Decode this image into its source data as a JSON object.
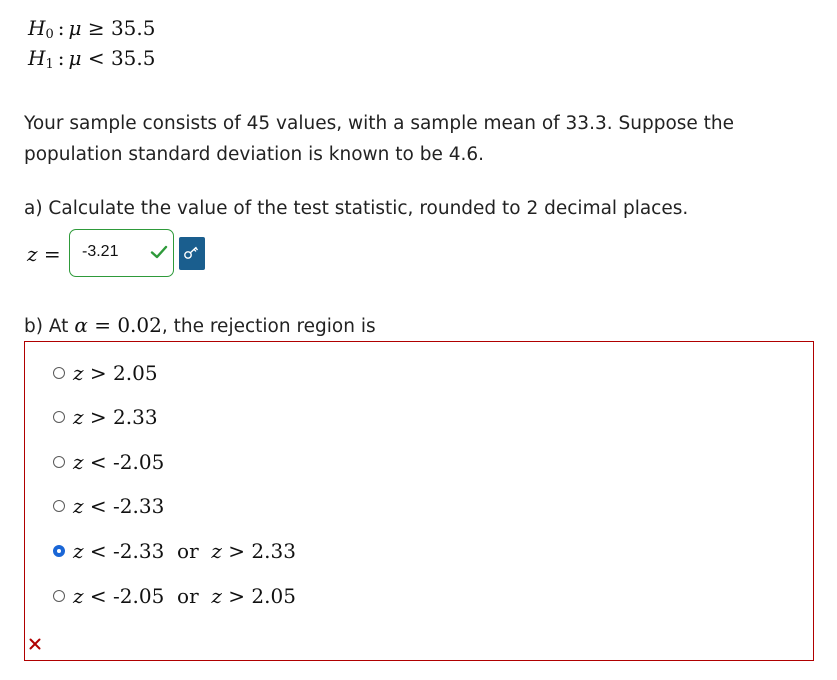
{
  "hypotheses": {
    "h0_sub": "0",
    "h0_rel": "≥",
    "h0_value": "35.5",
    "h1_sub": "1",
    "h1_rel": "<",
    "h1_value": "35.5"
  },
  "problem_text": "Your sample consists of 45 values, with a sample mean of 33.3. Suppose the population standard deviation is known to be 4.6.",
  "part_a": {
    "question": "a) Calculate the value of the test statistic, rounded to 2 decimal places.",
    "answer_value": "-3.21",
    "status": "correct",
    "accent_color": "#2e9a3a",
    "key_button_color": "#1a5e8e"
  },
  "part_b": {
    "prefix": "b) At",
    "alpha_value": "0.02",
    "suffix": ", the rejection region is",
    "status": "incorrect",
    "border_color": "#b00000",
    "options": [
      {
        "part1_rel": ">",
        "part1_val": "2.05",
        "connector": "",
        "part2_rel": "",
        "part2_val": "",
        "selected": false
      },
      {
        "part1_rel": ">",
        "part1_val": "2.33",
        "connector": "",
        "part2_rel": "",
        "part2_val": "",
        "selected": false
      },
      {
        "part1_rel": "<",
        "part1_val": "-2.05",
        "connector": "",
        "part2_rel": "",
        "part2_val": "",
        "selected": false
      },
      {
        "part1_rel": "<",
        "part1_val": "-2.33",
        "connector": "",
        "part2_rel": "",
        "part2_val": "",
        "selected": false
      },
      {
        "part1_rel": "<",
        "part1_val": "-2.33",
        "connector": "or",
        "part2_rel": ">",
        "part2_val": "2.33",
        "selected": true
      },
      {
        "part1_rel": "<",
        "part1_val": "-2.05",
        "connector": "or",
        "part2_rel": ">",
        "part2_val": "2.05",
        "selected": false
      }
    ]
  }
}
